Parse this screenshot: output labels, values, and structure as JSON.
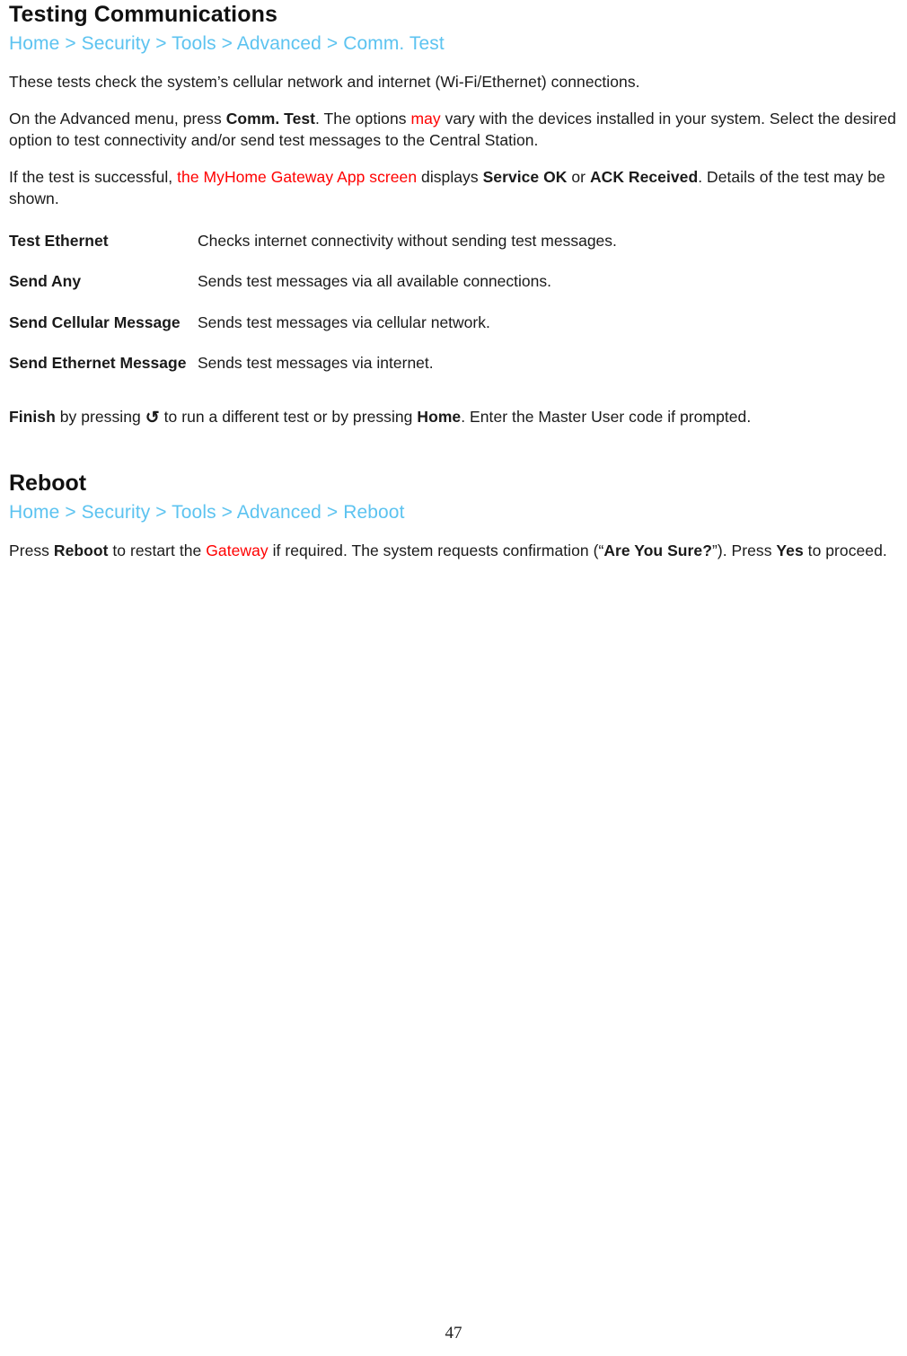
{
  "document": {
    "page_number": "47"
  },
  "comm_test": {
    "title": "Testing Communications",
    "breadcrumb": "Home > Security > Tools > Advanced > Comm. Test",
    "paragraph1": "These tests check the system’s cellular network and internet (Wi-Fi/Ethernet) connections.",
    "paragraph2": {
      "part1": "On the Advanced menu, press ",
      "bold1": "Comm. Test",
      "part2": ". The options ",
      "red1": "may",
      "part3": " vary with the devices installed in your system. Select the desired option to test connectivity and/or send test messages to the Central Station."
    },
    "paragraph3": {
      "part1": "If the test is successful, ",
      "red1": "the MyHome Gateway App screen",
      "part2": " displays ",
      "bold1": "Service OK",
      "part3": " or ",
      "bold2": "ACK Received",
      "part4": ". Details of the test may be shown."
    },
    "options_table": {
      "rows": [
        {
          "term": "Test Ethernet",
          "description": "Checks internet connectivity without sending test messages."
        },
        {
          "term": "Send Any",
          "description": "Sends test messages via all available connections."
        },
        {
          "term": "Send Cellular Message",
          "description": "Sends test messages via cellular network."
        },
        {
          "term": "Send Ethernet Message",
          "description": "Sends test messages via internet."
        }
      ]
    },
    "finish_paragraph": {
      "bold1": "Finish",
      "part1": " by pressing ",
      "glyph": "↺",
      "glyph_name": "return-back-arrow-icon",
      "part2": " to run a different test or by pressing ",
      "bold2": "Home",
      "part3": ". Enter the Master User code if prompted."
    }
  },
  "reboot": {
    "title": "Reboot",
    "breadcrumb": "Home > Security > Tools > Advanced > Reboot",
    "paragraph": {
      "part1": "Press ",
      "bold1": "Reboot",
      "part2": " to restart the ",
      "red1": "Gateway",
      "part3": " if required. The system requests confirmation (“",
      "bold2": "Are You Sure?",
      "part4": "”). Press ",
      "bold3": "Yes",
      "part5": " to proceed."
    }
  },
  "colors": {
    "breadcrumb_blue": "#5CC3F0",
    "emphasis_red": "#FF0000",
    "body_text": "#1A1A1A"
  }
}
